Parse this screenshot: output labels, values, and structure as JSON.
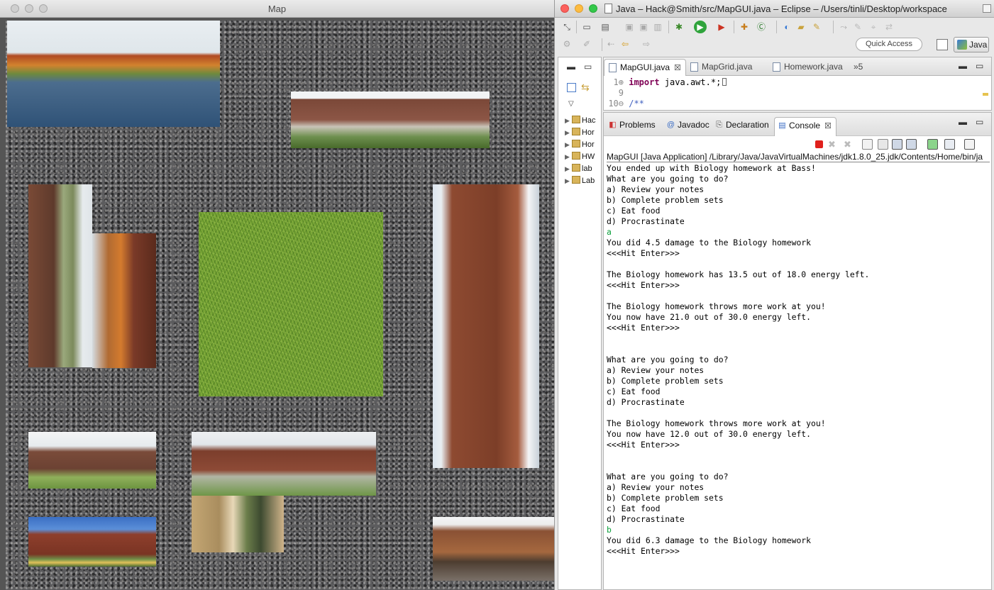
{
  "map_window": {
    "title": "Map"
  },
  "eclipse": {
    "title": "Java – Hack@Smith/src/MapGUI.java – Eclipse – /Users/tinli/Desktop/workspace",
    "quick_access": "Quick Access",
    "perspective": "Java",
    "package_explorer": {
      "items": [
        {
          "label": "Hac"
        },
        {
          "label": "Hor"
        },
        {
          "label": "Hor"
        },
        {
          "label": "HW"
        },
        {
          "label": "lab"
        },
        {
          "label": "Lab"
        }
      ]
    },
    "editor": {
      "tabs": [
        {
          "label": "MapGUI.java"
        },
        {
          "label": "MapGrid.java"
        },
        {
          "label": "Homework.java"
        }
      ],
      "overflow": "»5",
      "lines": [
        {
          "num": "1⊕",
          "keyword": "import",
          "rest": " java.awt.*;"
        },
        {
          "num": "9",
          "keyword": "",
          "rest": ""
        },
        {
          "num": "10⊖",
          "keyword": "",
          "rest": "/**"
        }
      ]
    },
    "console": {
      "tabs": [
        {
          "label": "Problems",
          "icon": "problems-icon"
        },
        {
          "label": "Javadoc",
          "icon": "at-icon"
        },
        {
          "label": "Declaration",
          "icon": "declaration-icon"
        },
        {
          "label": "Console",
          "icon": "console-icon"
        }
      ],
      "launch": "MapGUI [Java Application] /Library/Java/JavaVirtualMachines/jdk1.8.0_25.jdk/Contents/Home/bin/ja",
      "output": [
        {
          "text": "You ended up with Biology homework at Bass!",
          "input": false
        },
        {
          "text": "What are you going to do?",
          "input": false
        },
        {
          "text": "a) Review your notes",
          "input": false
        },
        {
          "text": "b) Complete problem sets",
          "input": false
        },
        {
          "text": "c) Eat food",
          "input": false
        },
        {
          "text": "d) Procrastinate",
          "input": false
        },
        {
          "text": "a",
          "input": true
        },
        {
          "text": "You did 4.5 damage to the Biology homework",
          "input": false
        },
        {
          "text": "<<<Hit Enter>>>",
          "input": false
        },
        {
          "text": "",
          "input": false
        },
        {
          "text": "The Biology homework has 13.5 out of 18.0 energy left.",
          "input": false
        },
        {
          "text": "<<<Hit Enter>>>",
          "input": false
        },
        {
          "text": "",
          "input": false
        },
        {
          "text": "The Biology homework throws more work at you!",
          "input": false
        },
        {
          "text": "You now have 21.0 out of 30.0 energy left.",
          "input": false
        },
        {
          "text": "<<<Hit Enter>>>",
          "input": false
        },
        {
          "text": "",
          "input": false
        },
        {
          "text": "",
          "input": false
        },
        {
          "text": "What are you going to do?",
          "input": false
        },
        {
          "text": "a) Review your notes",
          "input": false
        },
        {
          "text": "b) Complete problem sets",
          "input": false
        },
        {
          "text": "c) Eat food",
          "input": false
        },
        {
          "text": "d) Procrastinate",
          "input": false
        },
        {
          "text": "",
          "input": false
        },
        {
          "text": "The Biology homework throws more work at you!",
          "input": false
        },
        {
          "text": "You now have 12.0 out of 30.0 energy left.",
          "input": false
        },
        {
          "text": "<<<Hit Enter>>>",
          "input": false
        },
        {
          "text": "",
          "input": false
        },
        {
          "text": "",
          "input": false
        },
        {
          "text": "What are you going to do?",
          "input": false
        },
        {
          "text": "a) Review your notes",
          "input": false
        },
        {
          "text": "b) Complete problem sets",
          "input": false
        },
        {
          "text": "c) Eat food",
          "input": false
        },
        {
          "text": "d) Procrastinate",
          "input": false
        },
        {
          "text": "b",
          "input": true
        },
        {
          "text": "You did 6.3 damage to the Biology homework",
          "input": false
        },
        {
          "text": "<<<Hit Enter>>>",
          "input": false
        }
      ]
    }
  },
  "colors": {
    "input_text": "#0a9f3a",
    "keyword": "#7f0055",
    "comment": "#3f5fbf",
    "terminate_button": "#e0201c"
  }
}
